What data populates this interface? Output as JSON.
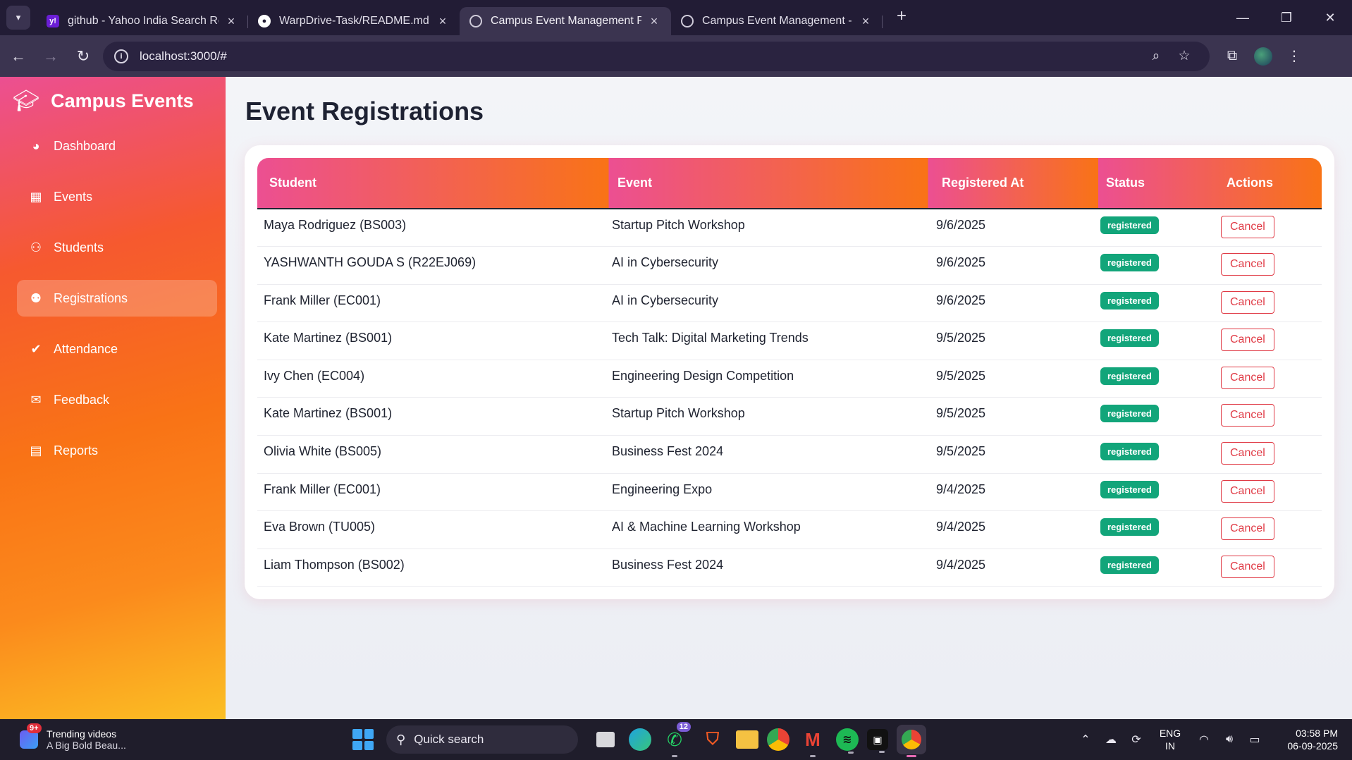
{
  "browser": {
    "tabs": [
      {
        "title": "github - Yahoo India Search Res",
        "favicon": "yahoo-icon",
        "active": false
      },
      {
        "title": "WarpDrive-Task/README.md at",
        "favicon": "github-icon",
        "active": false
      },
      {
        "title": "Campus Event Management Pla",
        "favicon": "globe-icon",
        "active": true
      },
      {
        "title": "Campus Event Management - S",
        "favicon": "globe-icon",
        "active": false
      }
    ],
    "url": "localhost:3000/#"
  },
  "sidebar": {
    "brand": "Campus Events",
    "items": [
      {
        "label": "Dashboard",
        "icon": "palette-icon"
      },
      {
        "label": "Events",
        "icon": "calendar-icon"
      },
      {
        "label": "Students",
        "icon": "users-icon"
      },
      {
        "label": "Registrations",
        "icon": "user-plus-icon",
        "active": true
      },
      {
        "label": "Attendance",
        "icon": "check-circle-icon"
      },
      {
        "label": "Feedback",
        "icon": "comments-icon"
      },
      {
        "label": "Reports",
        "icon": "bar-chart-icon"
      }
    ]
  },
  "main": {
    "title": "Event Registrations",
    "table": {
      "columns": [
        "Student",
        "Event",
        "Registered At",
        "Status",
        "Actions"
      ],
      "rows": [
        {
          "student": "Maya Rodriguez (BS003)",
          "event": "Startup Pitch Workshop",
          "registered_at": "9/6/2025",
          "status": "registered",
          "action": "Cancel"
        },
        {
          "student": "YASHWANTH GOUDA S (R22EJ069)",
          "event": "AI in Cybersecurity",
          "registered_at": "9/6/2025",
          "status": "registered",
          "action": "Cancel"
        },
        {
          "student": "Frank Miller (EC001)",
          "event": "AI in Cybersecurity",
          "registered_at": "9/6/2025",
          "status": "registered",
          "action": "Cancel"
        },
        {
          "student": "Kate Martinez (BS001)",
          "event": "Tech Talk: Digital Marketing Trends",
          "registered_at": "9/5/2025",
          "status": "registered",
          "action": "Cancel"
        },
        {
          "student": "Ivy Chen (EC004)",
          "event": "Engineering Design Competition",
          "registered_at": "9/5/2025",
          "status": "registered",
          "action": "Cancel"
        },
        {
          "student": "Kate Martinez (BS001)",
          "event": "Startup Pitch Workshop",
          "registered_at": "9/5/2025",
          "status": "registered",
          "action": "Cancel"
        },
        {
          "student": "Olivia White (BS005)",
          "event": "Business Fest 2024",
          "registered_at": "9/5/2025",
          "status": "registered",
          "action": "Cancel"
        },
        {
          "student": "Frank Miller (EC001)",
          "event": "Engineering Expo",
          "registered_at": "9/4/2025",
          "status": "registered",
          "action": "Cancel"
        },
        {
          "student": "Eva Brown (TU005)",
          "event": "AI & Machine Learning Workshop",
          "registered_at": "9/4/2025",
          "status": "registered",
          "action": "Cancel"
        },
        {
          "student": "Liam Thompson (BS002)",
          "event": "Business Fest 2024",
          "registered_at": "9/4/2025",
          "status": "registered",
          "action": "Cancel"
        }
      ]
    }
  },
  "taskbar": {
    "widget_title": "Trending videos",
    "widget_sub": "A Big Bold Beau...",
    "widget_badge": "9+",
    "search_placeholder": "Quick search",
    "whatsapp_badge": "12",
    "lang_line1": "ENG",
    "lang_line2": "IN",
    "time": "03:58 PM",
    "date": "06-09-2025"
  },
  "colors": {
    "accent_pink": "#ec4f92",
    "accent_orange": "#f97316",
    "status_green": "#12a57a",
    "cancel_red": "#e03a45"
  }
}
